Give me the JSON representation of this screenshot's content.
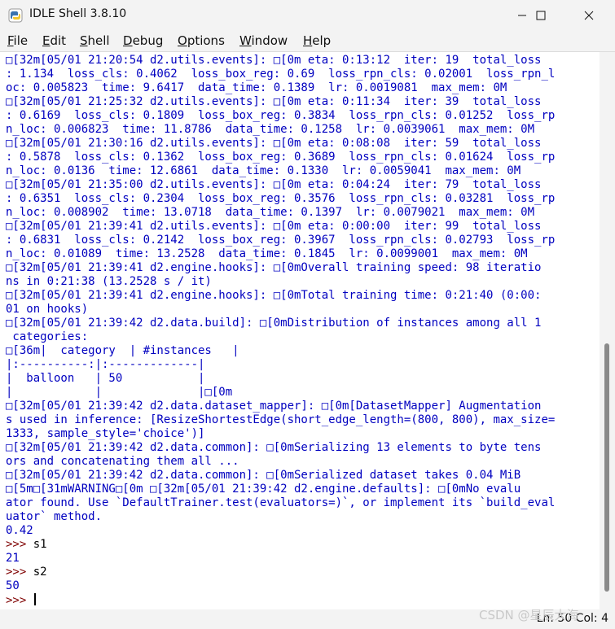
{
  "window": {
    "title": "IDLE Shell 3.8.10",
    "icon": "python-idle-icon",
    "controls": [
      "minimize-icon",
      "maximize-icon",
      "close-icon"
    ]
  },
  "menu": [
    {
      "label": "File",
      "key": "F",
      "rest": "ile"
    },
    {
      "label": "Edit",
      "key": "E",
      "rest": "dit"
    },
    {
      "label": "Shell",
      "key": "S",
      "rest": "hell"
    },
    {
      "label": "Debug",
      "key": "D",
      "rest": "ebug"
    },
    {
      "label": "Options",
      "key": "O",
      "rest": "ptions"
    },
    {
      "label": "Window",
      "key": "W",
      "rest": "indow"
    },
    {
      "label": "Help",
      "key": "H",
      "rest": "elp"
    }
  ],
  "shell": {
    "lines": [
      {
        "type": "out",
        "text": "□[32m[05/01 21:20:54 d2.utils.events]: □[0m eta: 0:13:12  iter: 19  total_loss"
      },
      {
        "type": "out",
        "text": ": 1.134  loss_cls: 0.4062  loss_box_reg: 0.69  loss_rpn_cls: 0.02001  loss_rpn_l"
      },
      {
        "type": "out",
        "text": "oc: 0.005823  time: 9.6417  data_time: 0.1389  lr: 0.0019081  max_mem: 0M"
      },
      {
        "type": "out",
        "text": "□[32m[05/01 21:25:32 d2.utils.events]: □[0m eta: 0:11:34  iter: 39  total_loss"
      },
      {
        "type": "out",
        "text": ": 0.6169  loss_cls: 0.1809  loss_box_reg: 0.3834  loss_rpn_cls: 0.01252  loss_rp"
      },
      {
        "type": "out",
        "text": "n_loc: 0.006823  time: 11.8786  data_time: 0.1258  lr: 0.0039061  max_mem: 0M"
      },
      {
        "type": "out",
        "text": "□[32m[05/01 21:30:16 d2.utils.events]: □[0m eta: 0:08:08  iter: 59  total_loss"
      },
      {
        "type": "out",
        "text": ": 0.5878  loss_cls: 0.1362  loss_box_reg: 0.3689  loss_rpn_cls: 0.01624  loss_rp"
      },
      {
        "type": "out",
        "text": "n_loc: 0.0136  time: 12.6861  data_time: 0.1330  lr: 0.0059041  max_mem: 0M"
      },
      {
        "type": "out",
        "text": "□[32m[05/01 21:35:00 d2.utils.events]: □[0m eta: 0:04:24  iter: 79  total_loss"
      },
      {
        "type": "out",
        "text": ": 0.6351  loss_cls: 0.2304  loss_box_reg: 0.3576  loss_rpn_cls: 0.03281  loss_rp"
      },
      {
        "type": "out",
        "text": "n_loc: 0.008902  time: 13.0718  data_time: 0.1397  lr: 0.0079021  max_mem: 0M"
      },
      {
        "type": "out",
        "text": "□[32m[05/01 21:39:41 d2.utils.events]: □[0m eta: 0:00:00  iter: 99  total_loss"
      },
      {
        "type": "out",
        "text": ": 0.6831  loss_cls: 0.2142  loss_box_reg: 0.3967  loss_rpn_cls: 0.02793  loss_rp"
      },
      {
        "type": "out",
        "text": "n_loc: 0.01089  time: 13.2528  data_time: 0.1845  lr: 0.0099001  max_mem: 0M"
      },
      {
        "type": "out",
        "text": "□[32m[05/01 21:39:41 d2.engine.hooks]: □[0mOverall training speed: 98 iteratio"
      },
      {
        "type": "out",
        "text": "ns in 0:21:38 (13.2528 s / it)"
      },
      {
        "type": "out",
        "text": "□[32m[05/01 21:39:41 d2.engine.hooks]: □[0mTotal training time: 0:21:40 (0:00:"
      },
      {
        "type": "out",
        "text": "01 on hooks)"
      },
      {
        "type": "out",
        "text": "□[32m[05/01 21:39:42 d2.data.build]: □[0mDistribution of instances among all 1"
      },
      {
        "type": "out",
        "text": " categories:"
      },
      {
        "type": "out",
        "text": "□[36m|  category  | #instances   |"
      },
      {
        "type": "out",
        "text": "|:----------:|:-------------|"
      },
      {
        "type": "out",
        "text": "|  balloon   | 50           |"
      },
      {
        "type": "out",
        "text": "|            |              |□[0m"
      },
      {
        "type": "out",
        "text": "□[32m[05/01 21:39:42 d2.data.dataset_mapper]: □[0m[DatasetMapper] Augmentation"
      },
      {
        "type": "out",
        "text": "s used in inference: [ResizeShortestEdge(short_edge_length=(800, 800), max_size="
      },
      {
        "type": "out",
        "text": "1333, sample_style='choice')]"
      },
      {
        "type": "out",
        "text": "□[32m[05/01 21:39:42 d2.data.common]: □[0mSerializing 13 elements to byte tens"
      },
      {
        "type": "out",
        "text": "ors and concatenating them all ..."
      },
      {
        "type": "out",
        "text": "□[32m[05/01 21:39:42 d2.data.common]: □[0mSerialized dataset takes 0.04 MiB"
      },
      {
        "type": "out",
        "text": "□[5m□[31mWARNING□[0m □[32m[05/01 21:39:42 d2.engine.defaults]: □[0mNo evalu"
      },
      {
        "type": "out",
        "text": "ator found. Use `DefaultTrainer.test(evaluators=)`, or implement its `build_eval"
      },
      {
        "type": "out",
        "text": "uator` method."
      },
      {
        "type": "out",
        "text": "0.42"
      },
      {
        "type": "in",
        "prompt": ">>> ",
        "text": "s1"
      },
      {
        "type": "out",
        "text": "21"
      },
      {
        "type": "in",
        "prompt": ">>> ",
        "text": "s2"
      },
      {
        "type": "out",
        "text": "50"
      },
      {
        "type": "in",
        "prompt": ">>> ",
        "text": "",
        "cursor": true
      }
    ]
  },
  "status": {
    "text": "Ln: 50  Col: 4"
  },
  "watermark": "CSDN @星辰大海",
  "colors": {
    "output": "#0000c0",
    "prompt": "#7f0000",
    "input": "#000000"
  }
}
